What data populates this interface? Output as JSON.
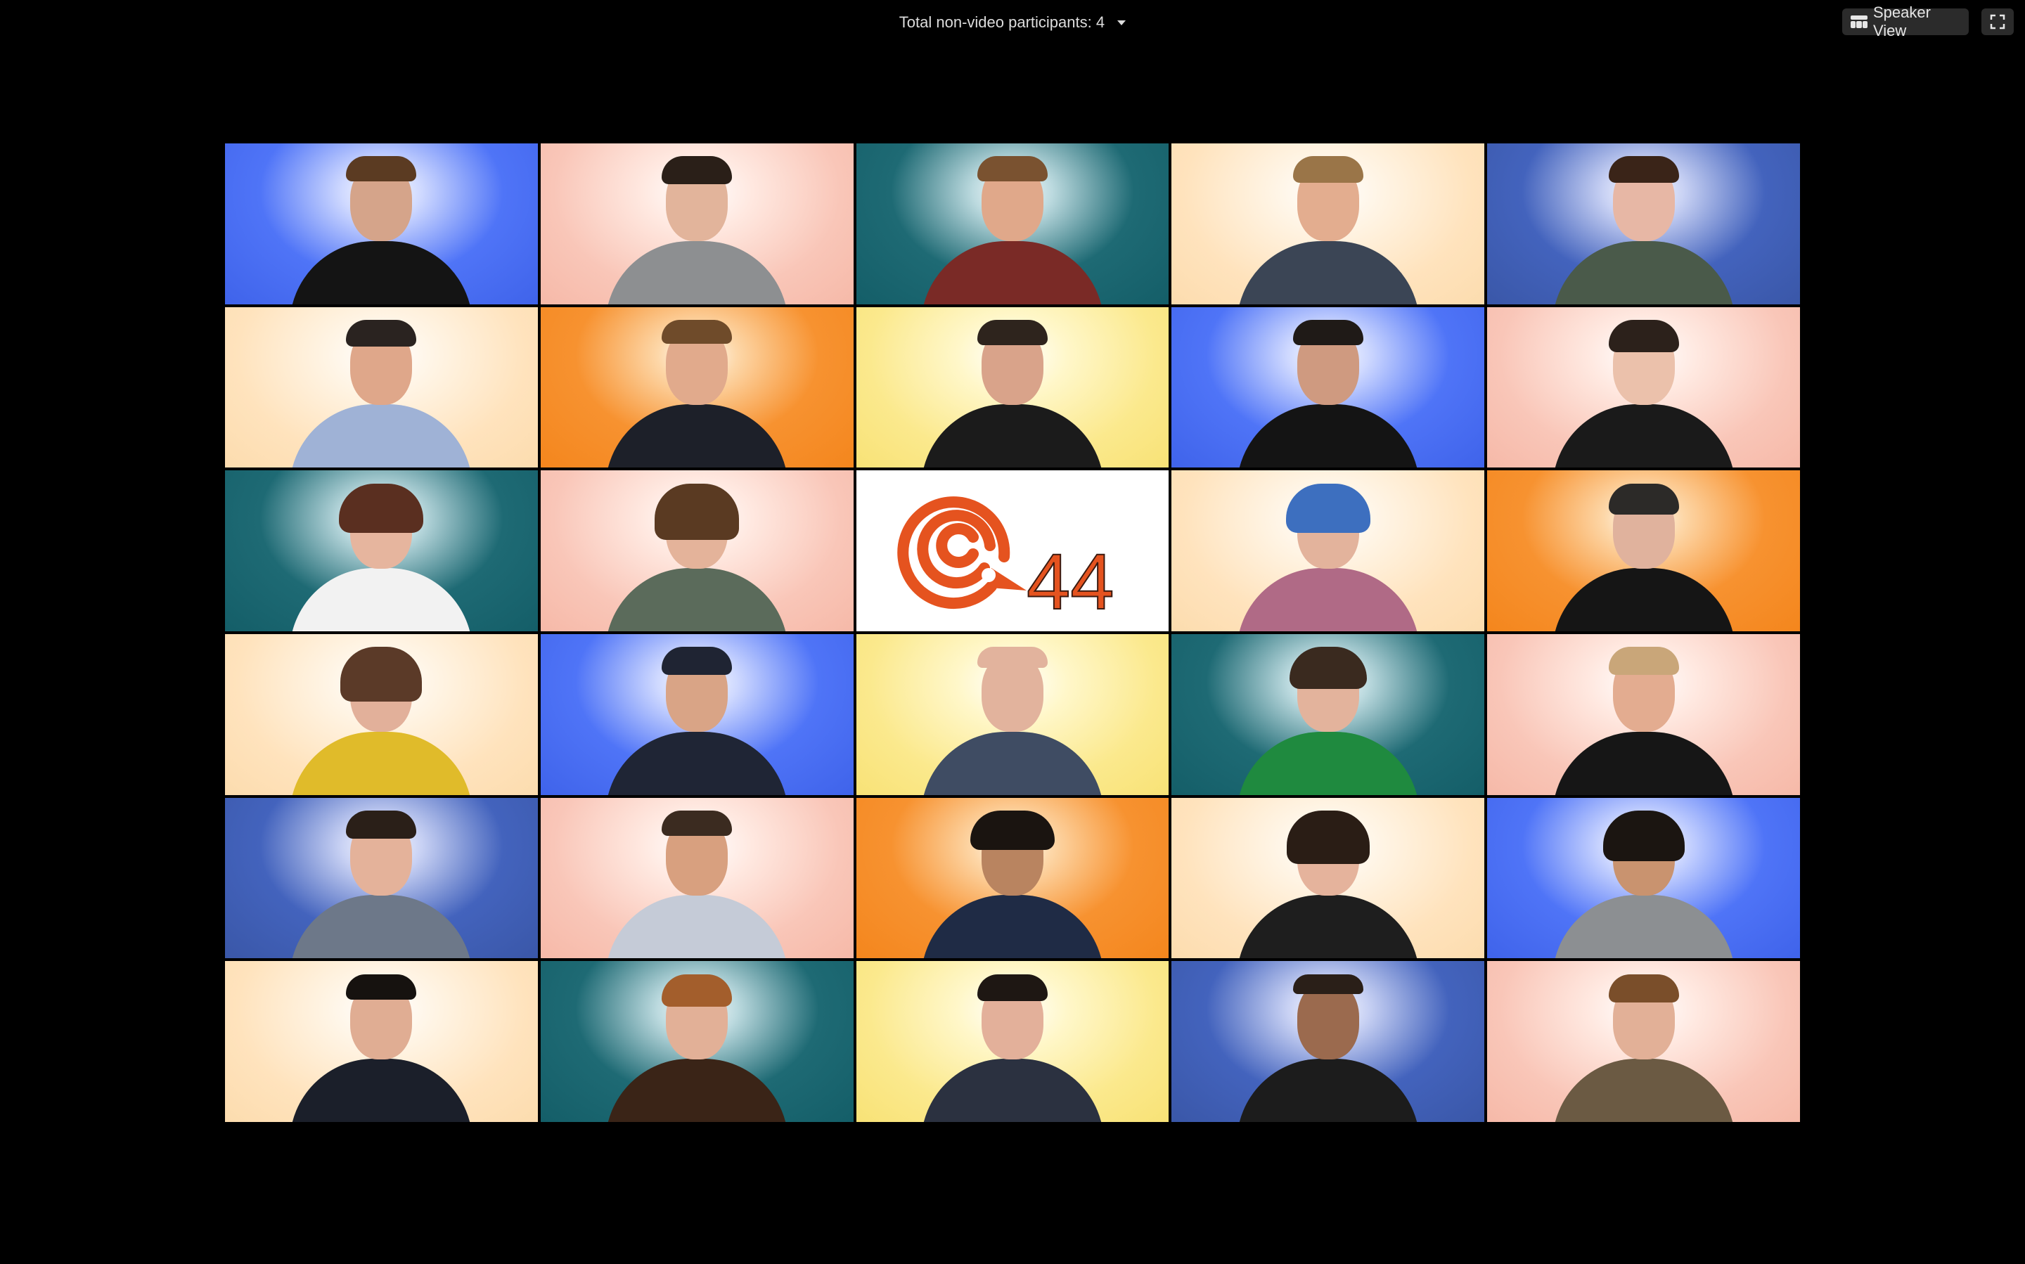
{
  "header": {
    "participants_label": "Total non-video participants: 4",
    "speaker_view_label": "Speaker View"
  },
  "icons": {
    "dropdown": "chevron-down-icon",
    "speaker_view": "speaker-view-icon",
    "fullscreen": "fullscreen-icon"
  },
  "logo": {
    "text": "44",
    "color": "#e5531f"
  }
}
